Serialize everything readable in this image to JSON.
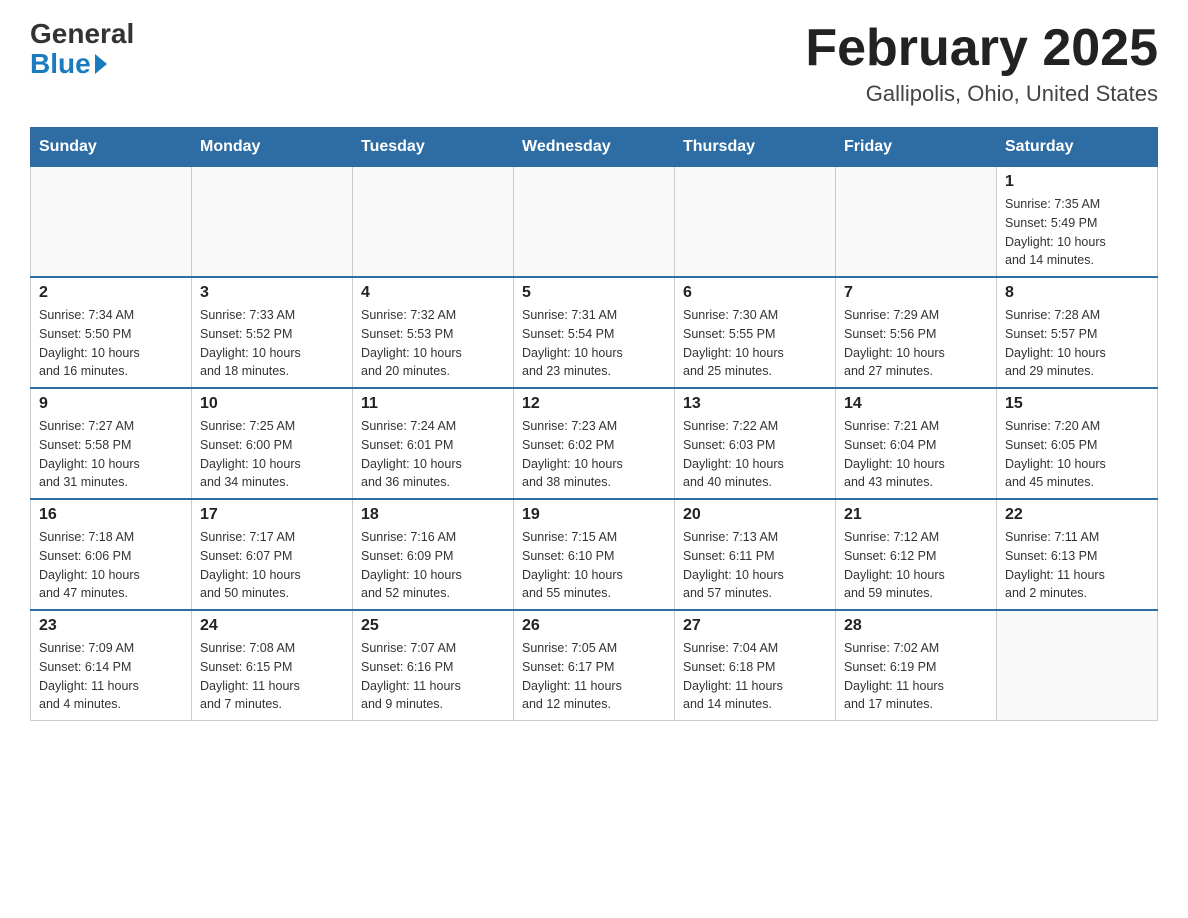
{
  "header": {
    "logo_general": "General",
    "logo_blue": "Blue",
    "month_year": "February 2025",
    "location": "Gallipolis, Ohio, United States"
  },
  "weekdays": [
    "Sunday",
    "Monday",
    "Tuesday",
    "Wednesday",
    "Thursday",
    "Friday",
    "Saturday"
  ],
  "weeks": [
    [
      {
        "day": "",
        "info": ""
      },
      {
        "day": "",
        "info": ""
      },
      {
        "day": "",
        "info": ""
      },
      {
        "day": "",
        "info": ""
      },
      {
        "day": "",
        "info": ""
      },
      {
        "day": "",
        "info": ""
      },
      {
        "day": "1",
        "info": "Sunrise: 7:35 AM\nSunset: 5:49 PM\nDaylight: 10 hours\nand 14 minutes."
      }
    ],
    [
      {
        "day": "2",
        "info": "Sunrise: 7:34 AM\nSunset: 5:50 PM\nDaylight: 10 hours\nand 16 minutes."
      },
      {
        "day": "3",
        "info": "Sunrise: 7:33 AM\nSunset: 5:52 PM\nDaylight: 10 hours\nand 18 minutes."
      },
      {
        "day": "4",
        "info": "Sunrise: 7:32 AM\nSunset: 5:53 PM\nDaylight: 10 hours\nand 20 minutes."
      },
      {
        "day": "5",
        "info": "Sunrise: 7:31 AM\nSunset: 5:54 PM\nDaylight: 10 hours\nand 23 minutes."
      },
      {
        "day": "6",
        "info": "Sunrise: 7:30 AM\nSunset: 5:55 PM\nDaylight: 10 hours\nand 25 minutes."
      },
      {
        "day": "7",
        "info": "Sunrise: 7:29 AM\nSunset: 5:56 PM\nDaylight: 10 hours\nand 27 minutes."
      },
      {
        "day": "8",
        "info": "Sunrise: 7:28 AM\nSunset: 5:57 PM\nDaylight: 10 hours\nand 29 minutes."
      }
    ],
    [
      {
        "day": "9",
        "info": "Sunrise: 7:27 AM\nSunset: 5:58 PM\nDaylight: 10 hours\nand 31 minutes."
      },
      {
        "day": "10",
        "info": "Sunrise: 7:25 AM\nSunset: 6:00 PM\nDaylight: 10 hours\nand 34 minutes."
      },
      {
        "day": "11",
        "info": "Sunrise: 7:24 AM\nSunset: 6:01 PM\nDaylight: 10 hours\nand 36 minutes."
      },
      {
        "day": "12",
        "info": "Sunrise: 7:23 AM\nSunset: 6:02 PM\nDaylight: 10 hours\nand 38 minutes."
      },
      {
        "day": "13",
        "info": "Sunrise: 7:22 AM\nSunset: 6:03 PM\nDaylight: 10 hours\nand 40 minutes."
      },
      {
        "day": "14",
        "info": "Sunrise: 7:21 AM\nSunset: 6:04 PM\nDaylight: 10 hours\nand 43 minutes."
      },
      {
        "day": "15",
        "info": "Sunrise: 7:20 AM\nSunset: 6:05 PM\nDaylight: 10 hours\nand 45 minutes."
      }
    ],
    [
      {
        "day": "16",
        "info": "Sunrise: 7:18 AM\nSunset: 6:06 PM\nDaylight: 10 hours\nand 47 minutes."
      },
      {
        "day": "17",
        "info": "Sunrise: 7:17 AM\nSunset: 6:07 PM\nDaylight: 10 hours\nand 50 minutes."
      },
      {
        "day": "18",
        "info": "Sunrise: 7:16 AM\nSunset: 6:09 PM\nDaylight: 10 hours\nand 52 minutes."
      },
      {
        "day": "19",
        "info": "Sunrise: 7:15 AM\nSunset: 6:10 PM\nDaylight: 10 hours\nand 55 minutes."
      },
      {
        "day": "20",
        "info": "Sunrise: 7:13 AM\nSunset: 6:11 PM\nDaylight: 10 hours\nand 57 minutes."
      },
      {
        "day": "21",
        "info": "Sunrise: 7:12 AM\nSunset: 6:12 PM\nDaylight: 10 hours\nand 59 minutes."
      },
      {
        "day": "22",
        "info": "Sunrise: 7:11 AM\nSunset: 6:13 PM\nDaylight: 11 hours\nand 2 minutes."
      }
    ],
    [
      {
        "day": "23",
        "info": "Sunrise: 7:09 AM\nSunset: 6:14 PM\nDaylight: 11 hours\nand 4 minutes."
      },
      {
        "day": "24",
        "info": "Sunrise: 7:08 AM\nSunset: 6:15 PM\nDaylight: 11 hours\nand 7 minutes."
      },
      {
        "day": "25",
        "info": "Sunrise: 7:07 AM\nSunset: 6:16 PM\nDaylight: 11 hours\nand 9 minutes."
      },
      {
        "day": "26",
        "info": "Sunrise: 7:05 AM\nSunset: 6:17 PM\nDaylight: 11 hours\nand 12 minutes."
      },
      {
        "day": "27",
        "info": "Sunrise: 7:04 AM\nSunset: 6:18 PM\nDaylight: 11 hours\nand 14 minutes."
      },
      {
        "day": "28",
        "info": "Sunrise: 7:02 AM\nSunset: 6:19 PM\nDaylight: 11 hours\nand 17 minutes."
      },
      {
        "day": "",
        "info": ""
      }
    ]
  ]
}
